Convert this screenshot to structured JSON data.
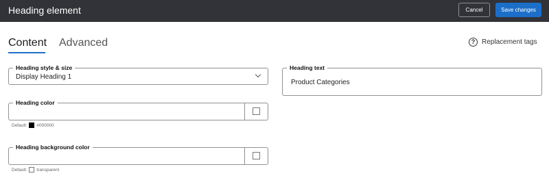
{
  "header": {
    "title": "Heading element",
    "cancel_label": "Cancel",
    "save_label": "Save changes"
  },
  "tabs": [
    {
      "label": "Content",
      "active": true
    },
    {
      "label": "Advanced",
      "active": false
    }
  ],
  "replacement_tags": {
    "label": "Replacement tags",
    "icon": "help-circle-icon",
    "glyph": "?"
  },
  "fields": {
    "heading_style": {
      "label": "Heading style & size",
      "value": "Display Heading 1",
      "icon": "chevron-down-icon"
    },
    "heading_color": {
      "label": "Heading color",
      "default_label": "Default:",
      "default_value": "#000000"
    },
    "heading_bg_color": {
      "label": "Heading background color",
      "default_label": "Default:",
      "default_value": "transparent"
    },
    "heading_text": {
      "label": "Heading text",
      "value": "Product Categories"
    }
  },
  "colors": {
    "accent": "#1c6fc9",
    "topbar": "#323338"
  }
}
